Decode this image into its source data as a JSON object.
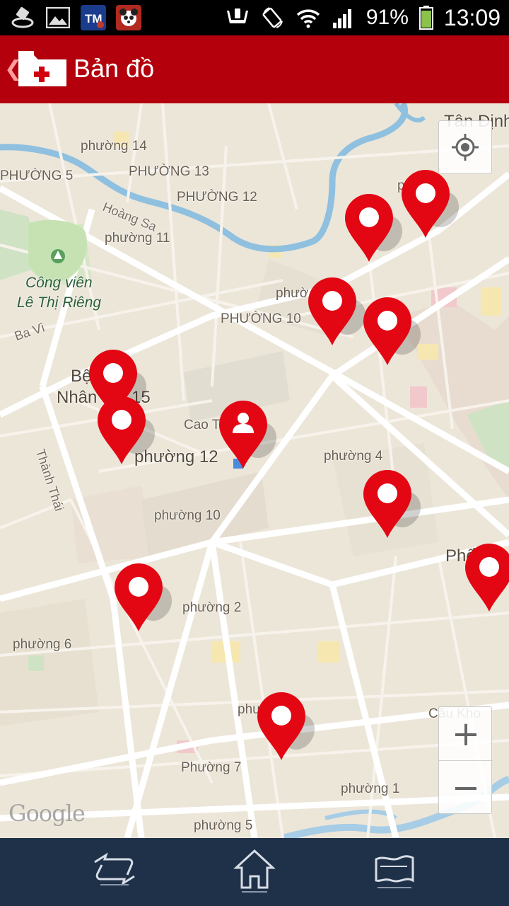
{
  "status_bar": {
    "battery": "91%",
    "time": "13:09",
    "notification_icons": [
      "gps-signal-icon",
      "gallery-icon",
      "tm-app-icon",
      "panda-app-icon"
    ],
    "system_icons": [
      "vibrate-icon",
      "rotate-icon",
      "wifi-icon",
      "signal-icon",
      "battery-icon"
    ]
  },
  "header": {
    "title": "Bản đồ",
    "icon": "first-aid-folder-icon",
    "back_icon": "back-chevron-icon"
  },
  "map": {
    "labels": {
      "tan_dinh": "Tân Định",
      "p14": "phường 14",
      "p5_upper": "PHƯỜNG 5",
      "p13_upper": "PHƯỜNG 13",
      "p12_upper": "PHƯỜNG 12",
      "hoang_sa": "Hoàng Sa",
      "p11": "phường 11",
      "p8_partial": "p 8",
      "park_line1": "Công viên",
      "park_line2": "Lê Thị Riêng",
      "phuo_partial": "phườ",
      "p10_upper": "PHƯỜNG 10",
      "ba_vi": "Ba Vì",
      "benh_partial": "Bệ",
      "nhan_partial": "Nhân",
      "num_15": "15",
      "cao_partial": "Cao T",
      "p12_center": "phường 12",
      "p4": "phường 4",
      "thanh_thai": "Thành Thái",
      "p10_lower": "phường 10",
      "pho_partial": "Phố",
      "p2": "phường 2",
      "p6": "phường 6",
      "phu_partial": "phư",
      "cau_kho": "Cầu Kho",
      "p7": "Phường 7",
      "p1": "phường 1",
      "p5_lower": "phường 5"
    },
    "attribution": "Google",
    "controls": {
      "my_location": "my-location-icon",
      "zoom_in": "+",
      "zoom_out": "−"
    },
    "pin_color": "#e30613",
    "user_pin_icon": "person-icon"
  },
  "bottom_nav": {
    "items": [
      "back-arrow-icon",
      "home-icon",
      "map-card-icon"
    ]
  },
  "colors": {
    "header_red": "#b3000c",
    "bottom_navy": "#1f3148",
    "map_bg": "#ece6d9",
    "river": "#8fc0e0"
  }
}
